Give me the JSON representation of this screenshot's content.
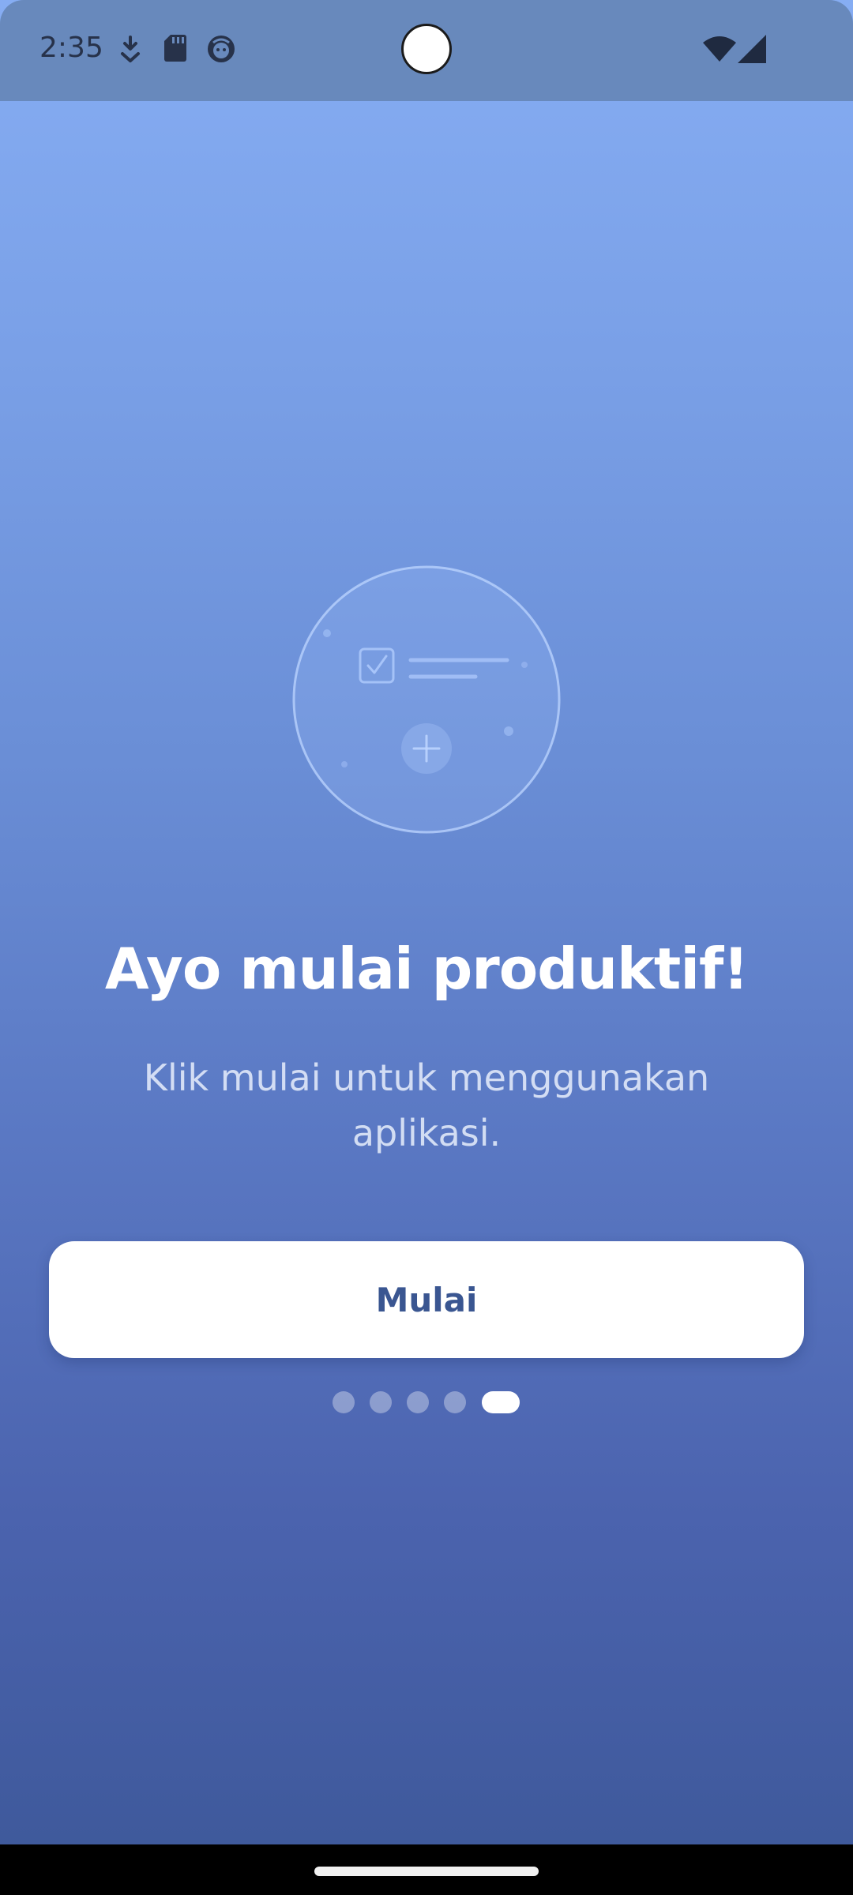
{
  "status_bar": {
    "time": "2:35",
    "left_icons": [
      "download-icon",
      "sd-card-icon",
      "face-icon"
    ],
    "right_icons": [
      "wifi-icon",
      "signal-icon"
    ]
  },
  "onboarding": {
    "title": "Ayo mulai produktif!",
    "subtitle": "Klik mulai untuk menggunakan aplikasi.",
    "button_label": "Mulai",
    "page_count": 5,
    "active_page": 5
  },
  "colors": {
    "gradient_top": "#86ADF3",
    "gradient_bottom": "#3D5899",
    "button_text": "#3A5691",
    "status_bar": "#6889BC"
  }
}
